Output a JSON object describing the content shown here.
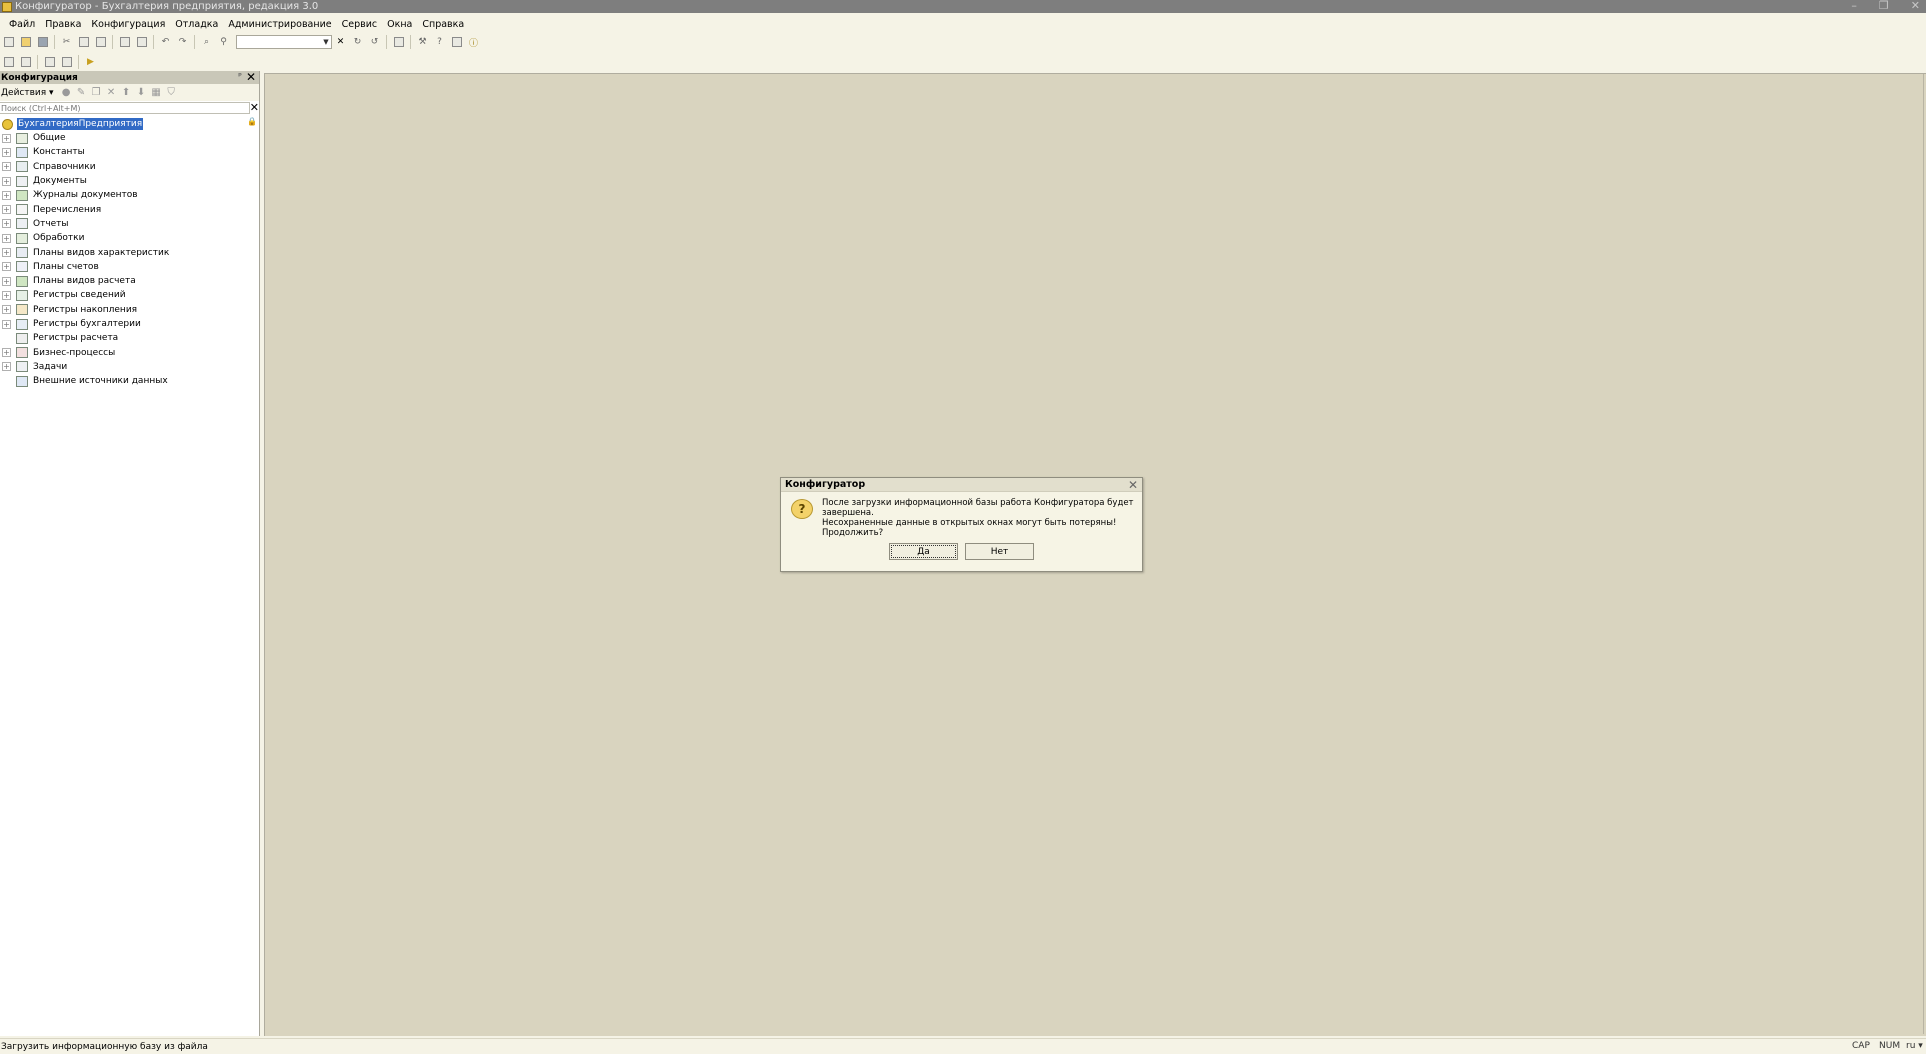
{
  "window": {
    "title": "Конфигуратор - Бухгалтерия предприятия, редакция 3.0",
    "controls": [
      "–",
      "❐",
      "✕"
    ]
  },
  "menu": [
    "Файл",
    "Правка",
    "Конфигурация",
    "Отладка",
    "Администрирование",
    "Сервис",
    "Окна",
    "Справка"
  ],
  "panel": {
    "title": "Конфигурация",
    "pin": "ᵖ",
    "close": "✕",
    "actions_label": "Действия ▾",
    "search_placeholder": "Поиск (Ctrl+Alt+M)",
    "search_clear": "✕",
    "root_label": "БухгалтерияПредприятия",
    "items": [
      {
        "label": "Общие",
        "expandable": true,
        "icon": "common-icon"
      },
      {
        "label": "Константы",
        "expandable": true,
        "icon": "constants-icon"
      },
      {
        "label": "Справочники",
        "expandable": true,
        "icon": "catalogs-icon"
      },
      {
        "label": "Документы",
        "expandable": true,
        "icon": "documents-icon"
      },
      {
        "label": "Журналы документов",
        "expandable": true,
        "icon": "journals-icon"
      },
      {
        "label": "Перечисления",
        "expandable": true,
        "icon": "enums-icon"
      },
      {
        "label": "Отчеты",
        "expandable": true,
        "icon": "reports-icon"
      },
      {
        "label": "Обработки",
        "expandable": true,
        "icon": "processing-icon"
      },
      {
        "label": "Планы видов характеристик",
        "expandable": true,
        "icon": "chart-of-characteristics-icon"
      },
      {
        "label": "Планы счетов",
        "expandable": true,
        "icon": "chart-of-accounts-icon"
      },
      {
        "label": "Планы видов расчета",
        "expandable": true,
        "icon": "calculation-types-icon"
      },
      {
        "label": "Регистры сведений",
        "expandable": true,
        "icon": "info-registers-icon"
      },
      {
        "label": "Регистры накопления",
        "expandable": true,
        "icon": "accumulation-registers-icon"
      },
      {
        "label": "Регистры бухгалтерии",
        "expandable": true,
        "icon": "accounting-registers-icon"
      },
      {
        "label": "Регистры расчета",
        "expandable": false,
        "icon": "calculation-registers-icon"
      },
      {
        "label": "Бизнес-процессы",
        "expandable": true,
        "icon": "business-processes-icon"
      },
      {
        "label": "Задачи",
        "expandable": true,
        "icon": "tasks-icon"
      },
      {
        "label": "Внешние источники данных",
        "expandable": false,
        "icon": "external-data-sources-icon"
      }
    ]
  },
  "dialog": {
    "title": "Конфигуратор",
    "close": "✕",
    "icon_glyph": "?",
    "lines": [
      "После загрузки информационной базы работа Конфигуратора будет завершена.",
      "Несохраненные данные в открытых окнах могут быть потеряны!",
      "Продолжить?"
    ],
    "yes_label": "Да",
    "no_label": "Нет"
  },
  "status": {
    "text": "Загрузить информационную базу из файла",
    "cap": "CAP",
    "num": "NUM",
    "lang": "ru ▾"
  }
}
